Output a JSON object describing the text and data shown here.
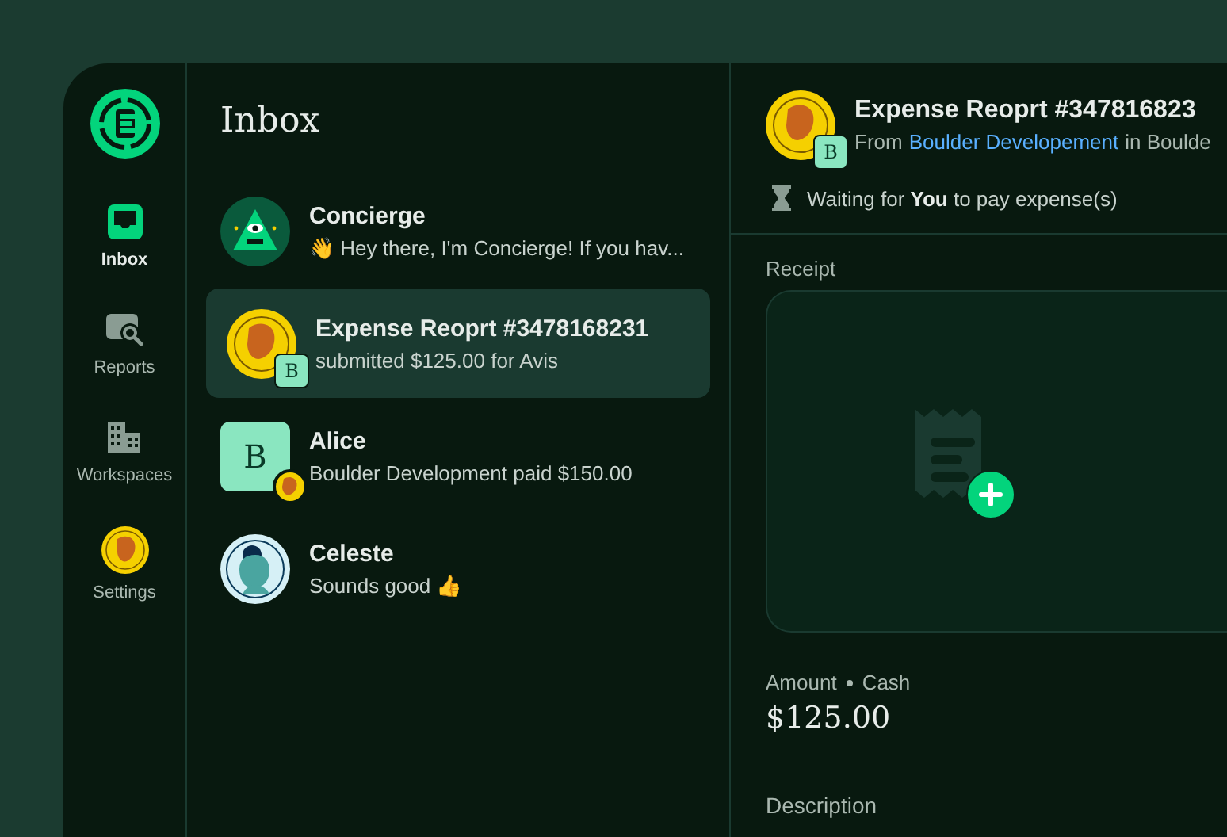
{
  "nav": [
    {
      "label": "Inbox",
      "kind": "inbox",
      "selected": true
    },
    {
      "label": "Reports",
      "kind": "reports",
      "selected": false
    },
    {
      "label": "Workspaces",
      "kind": "workspaces",
      "selected": false
    },
    {
      "label": "Settings",
      "kind": "avatar",
      "selected": false
    }
  ],
  "inbox": {
    "title": "Inbox",
    "chats": [
      {
        "name": "Concierge",
        "preview": "👋 Hey there, I'm Concierge! If you hav...",
        "kind": "concierge",
        "selected": false
      },
      {
        "name": "Expense Reoprt #3478168231",
        "preview": "submitted $125.00 for Avis",
        "kind": "coin-with-letter",
        "letter": "B",
        "selected": true
      },
      {
        "name": "Alice",
        "preview": "Boulder Development paid $150.00",
        "kind": "letter-with-coin",
        "letter": "B",
        "selected": false
      },
      {
        "name": "Celeste",
        "preview": "Sounds good 👍",
        "kind": "person",
        "selected": false
      }
    ]
  },
  "detail": {
    "title": "Expense Reoprt #347816823",
    "letter": "B",
    "from_prefix": "From",
    "from_link": "Boulder Developement",
    "from_suffix": "in Boulde",
    "status": "Waiting for **You** to pay expense(s)",
    "receipt_label": "Receipt",
    "amount_label": "Amount",
    "amount_source": "Cash",
    "amount": "$125.00",
    "description_label": "Description"
  }
}
